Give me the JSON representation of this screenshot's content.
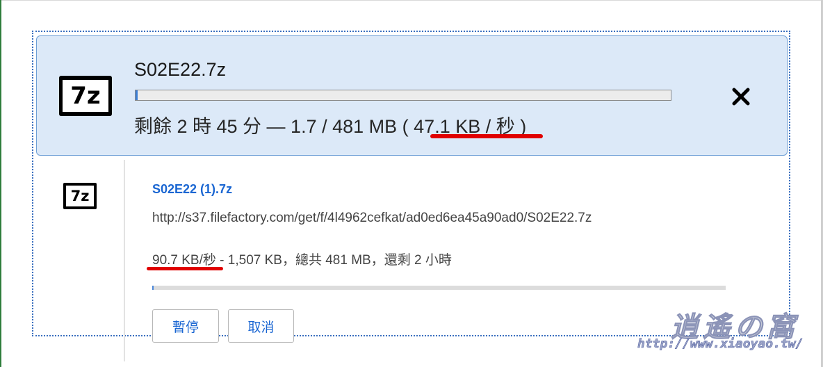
{
  "active_download": {
    "icon_label": "7z",
    "filename": "S02E22.7z",
    "progress_fraction": 0.0035,
    "status_prefix": "剩餘 2 時 45 分 — 1.7 / 481 MB (",
    "status_speed": "47.1 KB / 秒",
    "status_suffix": ")"
  },
  "download_item": {
    "icon_label": "7z",
    "filename": "S02E22 (1).7z",
    "url": "http://s37.filefactory.com/get/f/4l4962cefkat/ad0ed6ea45a90ad0/S02E22.7z",
    "speed": "90.7 KB/秒",
    "status_rest": " - 1,507 KB，總共 481 MB，還剩 2 小時",
    "progress_fraction": 0.003,
    "pause_label": "暫停",
    "cancel_label": "取消"
  },
  "watermark": {
    "cjk": "逍遙の窩",
    "url": "http://www.xiaoyao.tw/"
  },
  "colors": {
    "active_bg": "#dce9f8",
    "link_blue": "#1a66d2",
    "annotation_red": "#e00000"
  },
  "icons": {
    "close": "close-icon",
    "archive": "7z-file-icon"
  }
}
